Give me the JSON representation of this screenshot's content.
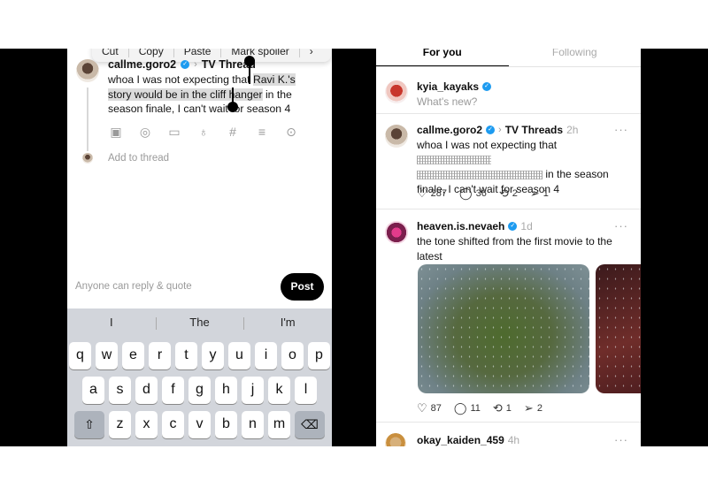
{
  "composer": {
    "context_menu": [
      "Cut",
      "Copy",
      "Paste",
      "Mark spoiler",
      "›"
    ],
    "username": "callme.goro2",
    "verified_mark": "✓",
    "breadcrumb_chevron": "›",
    "topic": "TV Thread",
    "text_before": "whoa I was not expecting that ",
    "text_selected": "Ravi K.'s story would be in the cliff hanger",
    "text_after": " in the season finale, I can't wait for season 4",
    "tool_icons": [
      "image-icon",
      "camera-icon",
      "gif-icon",
      "mic-icon",
      "hashtag-icon",
      "list-icon",
      "location-icon"
    ],
    "add_to_thread": "Add to thread",
    "reply_setting": "Anyone can reply & quote",
    "post_label": "Post"
  },
  "keyboard": {
    "suggestions": [
      "I",
      "The",
      "I'm"
    ],
    "row1": [
      "q",
      "w",
      "e",
      "r",
      "t",
      "y",
      "u",
      "i",
      "o",
      "p"
    ],
    "row2": [
      "a",
      "s",
      "d",
      "f",
      "g",
      "h",
      "j",
      "k",
      "l"
    ],
    "row3": [
      "z",
      "x",
      "c",
      "v",
      "b",
      "n",
      "m"
    ]
  },
  "feed": {
    "tabs": [
      "For you",
      "Following"
    ],
    "compose": {
      "username": "kyia_kayaks",
      "placeholder": "What's new?"
    },
    "posts": [
      {
        "username": "callme.goro2",
        "topic": "TV Threads",
        "time": "2h",
        "text_before": "whoa I was not expecting that",
        "text_after": "in the season finale, I can't wait for season 4",
        "likes": "287",
        "replies": "36",
        "reposts": "2",
        "shares": "1"
      },
      {
        "username": "heaven.is.nevaeh",
        "time": "1d",
        "text": "the tone shifted from the first movie to the latest",
        "likes": "87",
        "replies": "11",
        "reposts": "1",
        "shares": "2"
      },
      {
        "username": "okay_kaiden_459",
        "time": "4h"
      }
    ],
    "more_label": "···"
  },
  "colors": {
    "verified": "#1d9bf0",
    "post_button": "#000000",
    "keyboard_bg": "#d2d5db"
  }
}
